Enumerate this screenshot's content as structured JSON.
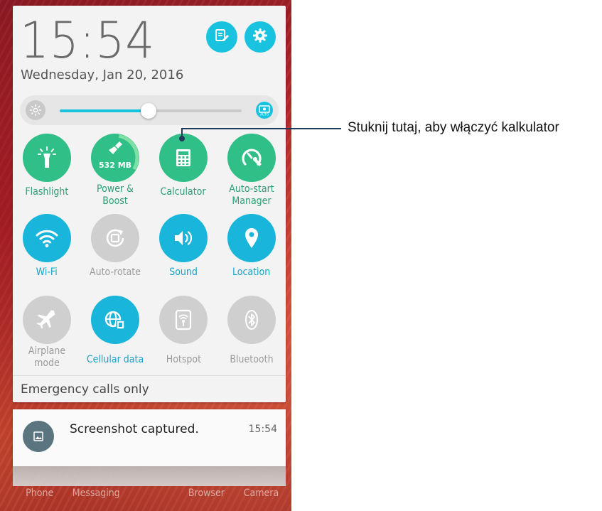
{
  "status": {
    "time": "15:54",
    "date": "Wednesday, Jan 20, 2016"
  },
  "header_buttons": {
    "edit_icon": "edit-icon",
    "settings_icon": "gear-icon"
  },
  "brightness": {
    "level": 0.49,
    "auto_label": "AUTO"
  },
  "tiles": [
    {
      "label": "Flashlight",
      "state": "on",
      "icon": "flashlight-icon"
    },
    {
      "label": "Power & Boost",
      "state": "on",
      "icon": "broom-icon",
      "badge": "532 MB"
    },
    {
      "label": "Calculator",
      "state": "on",
      "icon": "calculator-icon"
    },
    {
      "label": "Auto-start Manager",
      "state": "on",
      "icon": "autostart-icon"
    },
    {
      "label": "Wi-Fi",
      "state": "on",
      "icon": "wifi-icon"
    },
    {
      "label": "Auto-rotate",
      "state": "off",
      "icon": "rotate-icon"
    },
    {
      "label": "Sound",
      "state": "on",
      "icon": "sound-icon"
    },
    {
      "label": "Location",
      "state": "on",
      "icon": "location-icon"
    },
    {
      "label": "Airplane mode",
      "state": "off",
      "icon": "airplane-icon"
    },
    {
      "label": "Cellular data",
      "state": "on",
      "icon": "cellular-data-icon"
    },
    {
      "label": "Hotspot",
      "state": "off",
      "icon": "hotspot-icon"
    },
    {
      "label": "Bluetooth",
      "state": "off",
      "icon": "bluetooth-icon"
    }
  ],
  "emergency": "Emergency calls only",
  "notification": {
    "title": "Screenshot captured.",
    "time": "15:54"
  },
  "dock": [
    "Phone",
    "Messaging",
    "Browser",
    "Camera"
  ],
  "callout": "Stuknij tutaj, aby włączyć kalkulator",
  "colors": {
    "green": "#2fbf87",
    "cyan": "#19b5db",
    "grey": "#cfcfcf",
    "callout_line": "#1f3a5c"
  }
}
